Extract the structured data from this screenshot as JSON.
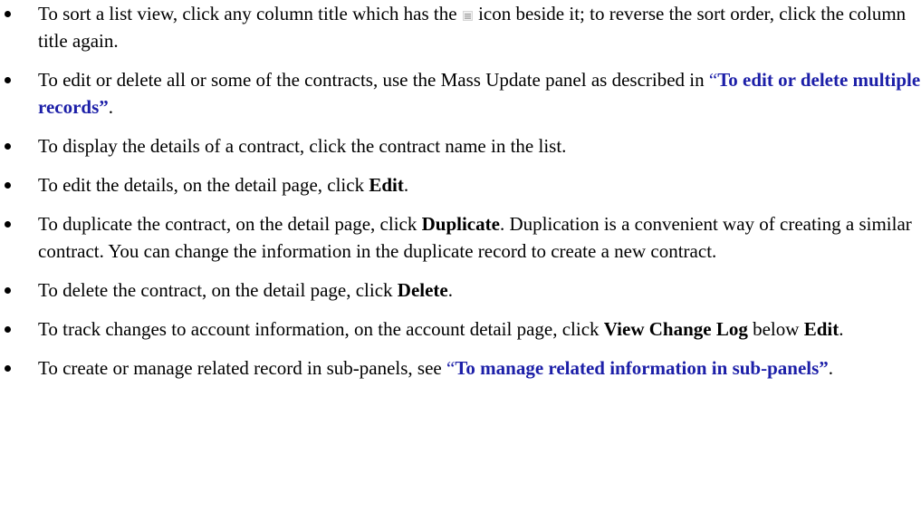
{
  "items": [
    {
      "t1": "To sort a list view, click any column title which has the",
      "icon": "sort-icon",
      "t2": "icon beside it; to reverse the sort order, click the column title again."
    },
    {
      "t1": "To edit or delete all or some of the contracts, use the Mass Update panel as described in",
      "q_open": "“",
      "link": "To edit or delete multiple records”",
      "t2": "."
    },
    {
      "t1": "To display the details of a contract, click the contract name in the list."
    },
    {
      "t1": "To edit the details, on the detail page, click",
      "bold": "Edit",
      "t2": "."
    },
    {
      "t1": "To duplicate the contract, on the detail page, click",
      "bold": "Duplicate",
      "t2": ". Duplication is a convenient way of creating a similar contract. You can change the information in the duplicate record to create a new contract."
    },
    {
      "t1": "To delete the contract, on the detail page, click",
      "bold": "Delete",
      "t2": "."
    },
    {
      "t1": "To track changes to account information, on the account detail page, click",
      "bold": "View Change Log",
      "t2": "below",
      "bold2": "Edit",
      "t3": "."
    },
    {
      "t1": "To create or manage related record in sub-panels, see",
      "q_open": "“",
      "link": "To manage related information in sub-panels”",
      "t2": "."
    }
  ],
  "colors": {
    "link": "#1c1fa8",
    "text": "#000000"
  }
}
